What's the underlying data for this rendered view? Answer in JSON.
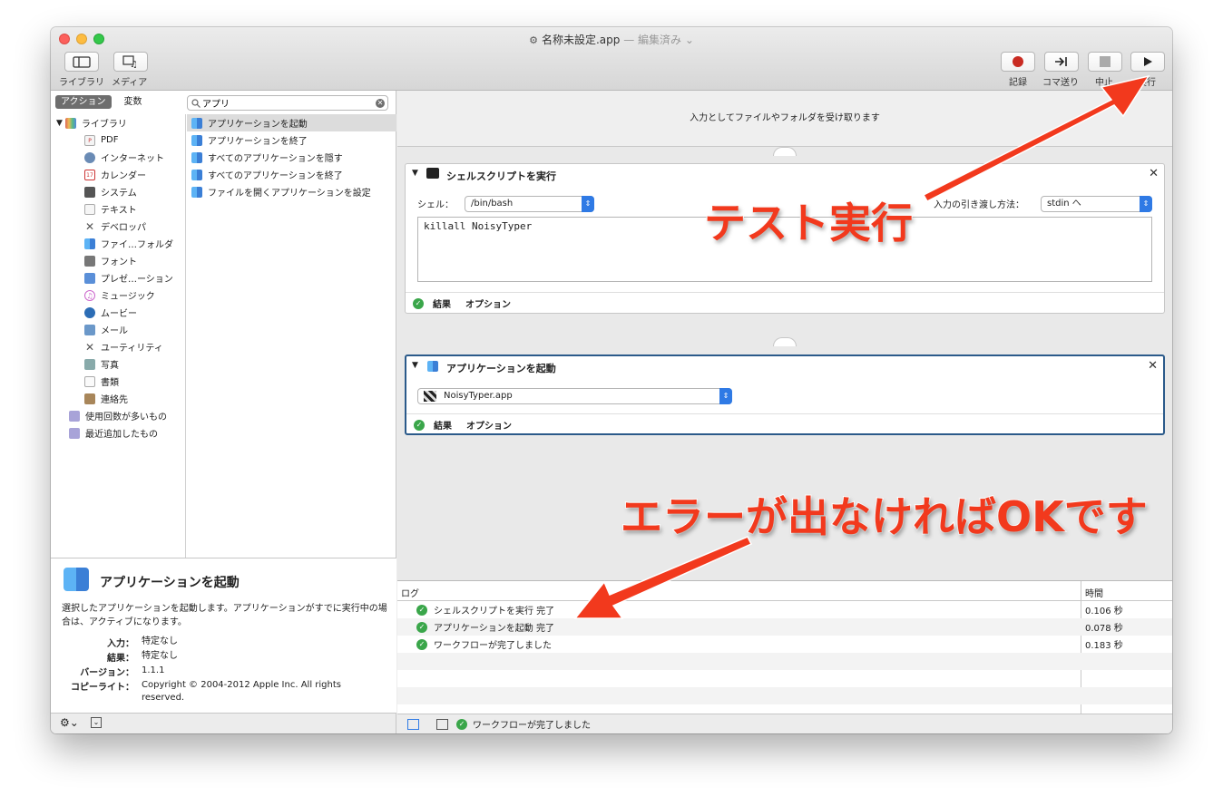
{
  "window": {
    "title": "名称未設定.app",
    "edited_suffix": " — 編集済み ⌄"
  },
  "toolbar": {
    "library_label": "ライブラリ",
    "media_label": "メディア",
    "record_label": "記録",
    "step_label": "コマ送り",
    "stop_label": "中止",
    "run_label": "実行"
  },
  "left": {
    "seg_actions": "アクション",
    "seg_variables": "変数",
    "search_value": "アプリ",
    "categories": [
      {
        "label": "ライブラリ",
        "icon": "library-icon"
      },
      {
        "label": "PDF",
        "icon": "pdf-icon"
      },
      {
        "label": "インターネット",
        "icon": "internet-icon"
      },
      {
        "label": "カレンダー",
        "icon": "calendar-icon"
      },
      {
        "label": "システム",
        "icon": "system-icon"
      },
      {
        "label": "テキスト",
        "icon": "text-icon"
      },
      {
        "label": "デベロッパ",
        "icon": "developer-icon"
      },
      {
        "label": "ファイ…フォルダ",
        "icon": "finder-icon"
      },
      {
        "label": "フォント",
        "icon": "font-icon"
      },
      {
        "label": "プレゼ…ーション",
        "icon": "presentation-icon"
      },
      {
        "label": "ミュージック",
        "icon": "music-icon"
      },
      {
        "label": "ムービー",
        "icon": "movie-icon"
      },
      {
        "label": "メール",
        "icon": "mail-icon"
      },
      {
        "label": "ユーティリティ",
        "icon": "utility-icon"
      },
      {
        "label": "写真",
        "icon": "photo-icon"
      },
      {
        "label": "書類",
        "icon": "document-icon"
      },
      {
        "label": "連絡先",
        "icon": "contacts-icon"
      },
      {
        "label": "使用回数が多いもの",
        "icon": "smart-folder-icon"
      },
      {
        "label": "最近追加したもの",
        "icon": "smart-folder-icon"
      }
    ],
    "actions": [
      "アプリケーションを起動",
      "アプリケーションを終了",
      "すべてのアプリケーションを隠す",
      "すべてのアプリケーションを終了",
      "ファイルを開くアプリケーションを設定"
    ],
    "description": {
      "title": "アプリケーションを起動",
      "text": "選択したアプリケーションを起動します。アプリケーションがすでに実行中の場合は、アクティブになります。",
      "input_key": "入力：",
      "input_value": "特定なし",
      "result_key": "結果：",
      "result_value": "特定なし",
      "version_key": "バージョン：",
      "version_value": "1.1.1",
      "copyright_key": "コピーライト：",
      "copyright_value": "Copyright © 2004-2012 Apple Inc.  All rights reserved."
    }
  },
  "workflow": {
    "input_banner": "入力としてファイルやフォルダを受け取ります",
    "shell_action": {
      "title": "シェルスクリプトを実行",
      "shell_label": "シェル：",
      "shell_value": "/bin/bash",
      "pass_input_label": "入力の引き渡し方法：",
      "pass_input_value": "stdin へ",
      "script": "killall NoisyTyper",
      "results": "結果",
      "options": "オプション"
    },
    "launch_action": {
      "title": "アプリケーションを起動",
      "app_value": "NoisyTyper.app",
      "results": "結果",
      "options": "オプション"
    }
  },
  "log": {
    "col_log": "ログ",
    "col_time": "時間",
    "rows": [
      {
        "text": "シェルスクリプトを実行 完了",
        "time": "0.106 秒"
      },
      {
        "text": "アプリケーションを起動 完了",
        "time": "0.078 秒"
      },
      {
        "text": "ワークフローが完了しました",
        "time": "0.183 秒"
      }
    ],
    "status": "ワークフローが完了しました"
  },
  "annotations": {
    "test_run": "テスト実行",
    "no_error_ok": "エラーが出なければOKです"
  },
  "colors": {
    "annotation": "#f2391d",
    "selected_border": "#2b5a8a",
    "success": "#3aa64a"
  }
}
